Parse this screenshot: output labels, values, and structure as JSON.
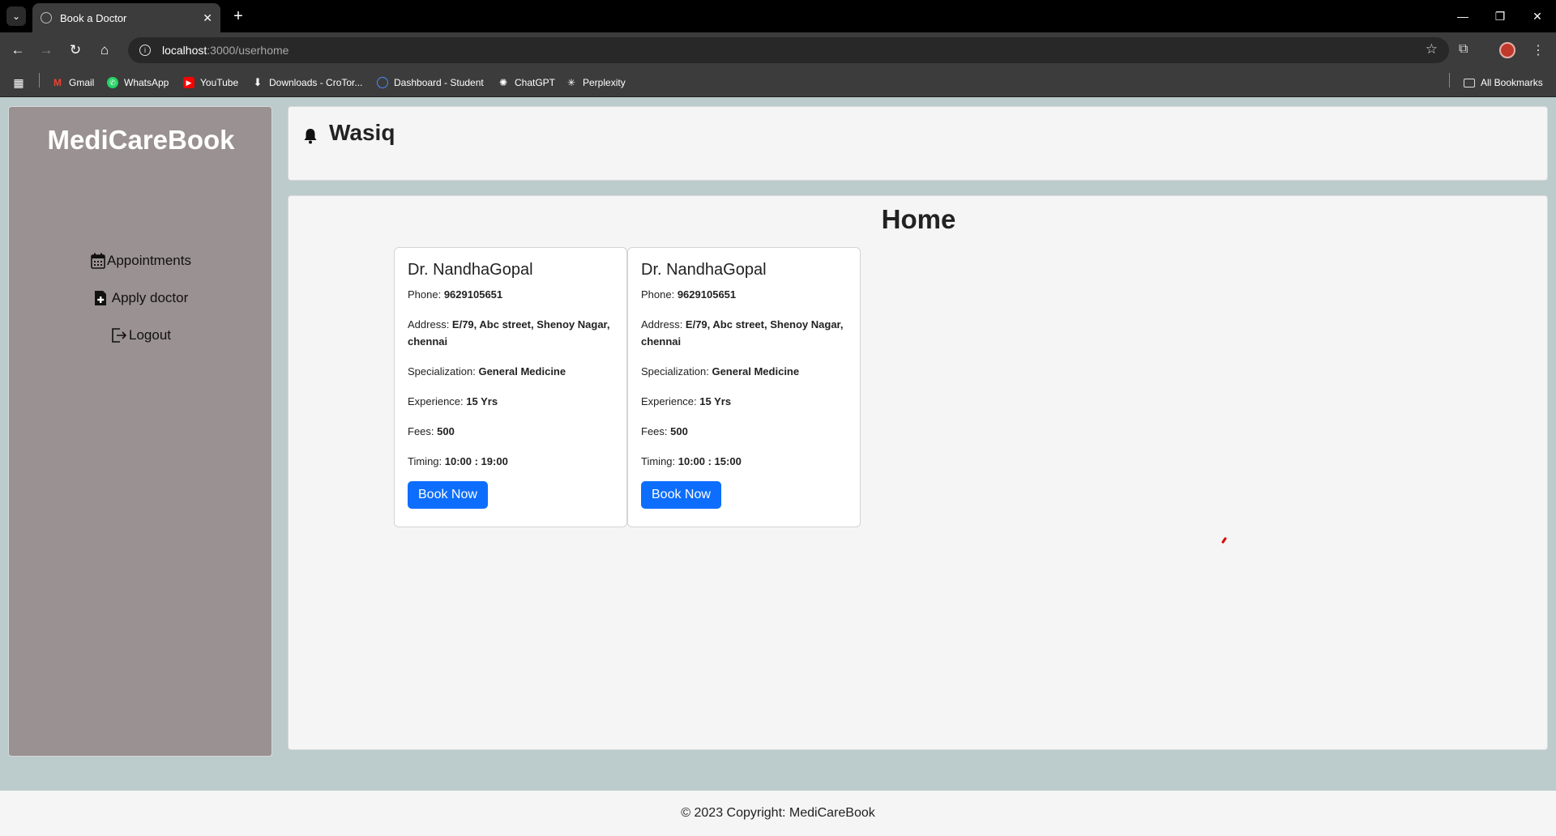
{
  "browser": {
    "tab_title": "Book a Doctor",
    "url_host": "localhost",
    "url_path": ":3000/userhome",
    "bookmarks": [
      "Gmail",
      "WhatsApp",
      "YouTube",
      "Downloads - CroTor...",
      "Dashboard - Student",
      "ChatGPT",
      "Perplexity"
    ],
    "all_bookmarks": "All Bookmarks"
  },
  "sidebar": {
    "brand": "MediCareBook",
    "items": [
      {
        "label": "Appointments",
        "icon": "calendar-icon"
      },
      {
        "label": "Apply doctor",
        "icon": "medical-doc-icon"
      },
      {
        "label": "Logout",
        "icon": "logout-icon"
      }
    ]
  },
  "header": {
    "user_name": "Wasiq",
    "icon": "bell-icon"
  },
  "main": {
    "title": "Home",
    "labels": {
      "phone": "Phone: ",
      "address": "Address: ",
      "specialization": "Specialization: ",
      "experience": "Experience: ",
      "fees": "Fees: ",
      "timing": "Timing: "
    },
    "doctors": [
      {
        "name": "Dr. NandhaGopal",
        "phone": "9629105651",
        "address": "E/79, Abc street, Shenoy Nagar, chennai",
        "specialization": "General Medicine",
        "experience": "15 Yrs",
        "fees": "500",
        "timing": "10:00 : 19:00",
        "button": "Book Now"
      },
      {
        "name": "Dr. NandhaGopal",
        "phone": "9629105651",
        "address": "E/79, Abc street, Shenoy Nagar, chennai",
        "specialization": "General Medicine",
        "experience": "15 Yrs",
        "fees": "500",
        "timing": "10:00 : 15:00",
        "button": "Book Now"
      }
    ]
  },
  "footer": {
    "copyright": "© 2023 Copyright: MediCareBook"
  },
  "colors": {
    "sidebar_bg": "#9a9192",
    "page_bg": "#bccbcb",
    "primary_button": "#0d6efd"
  }
}
